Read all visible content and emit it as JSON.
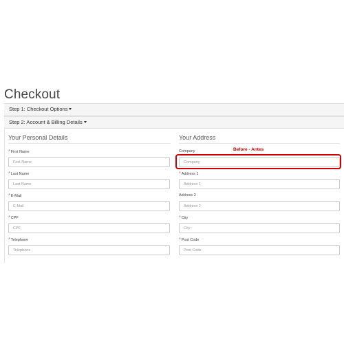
{
  "page": {
    "title": "Checkout"
  },
  "steps": [
    {
      "label": "Step 1: Checkout Options"
    },
    {
      "label": "Step 2: Account & Billing Details"
    }
  ],
  "personal": {
    "title": "Your Personal Details",
    "fields": [
      {
        "label": "First Name",
        "placeholder": "First Name",
        "required": true
      },
      {
        "label": "Last Name",
        "placeholder": "Last Name",
        "required": true
      },
      {
        "label": "E-Mail",
        "placeholder": "E-Mail",
        "required": true
      },
      {
        "label": "CPF",
        "placeholder": "CPF",
        "required": true
      },
      {
        "label": "Telephone",
        "placeholder": "Telephone",
        "required": true
      }
    ]
  },
  "address": {
    "title": "Your Address",
    "fields": [
      {
        "label": "Company",
        "placeholder": "Company",
        "required": false
      },
      {
        "label": "Address 1",
        "placeholder": "Address 1",
        "required": true
      },
      {
        "label": "Address 2",
        "placeholder": "Address 2",
        "required": false
      },
      {
        "label": "City",
        "placeholder": "City",
        "required": true
      },
      {
        "label": "Post Code",
        "placeholder": "Post Code",
        "required": true
      }
    ]
  },
  "annotation": {
    "text": "Before - Antes",
    "color": "#cc0000"
  },
  "colors": {
    "required_marker": "#d9534f",
    "panel_background": "#f5f5f5"
  }
}
